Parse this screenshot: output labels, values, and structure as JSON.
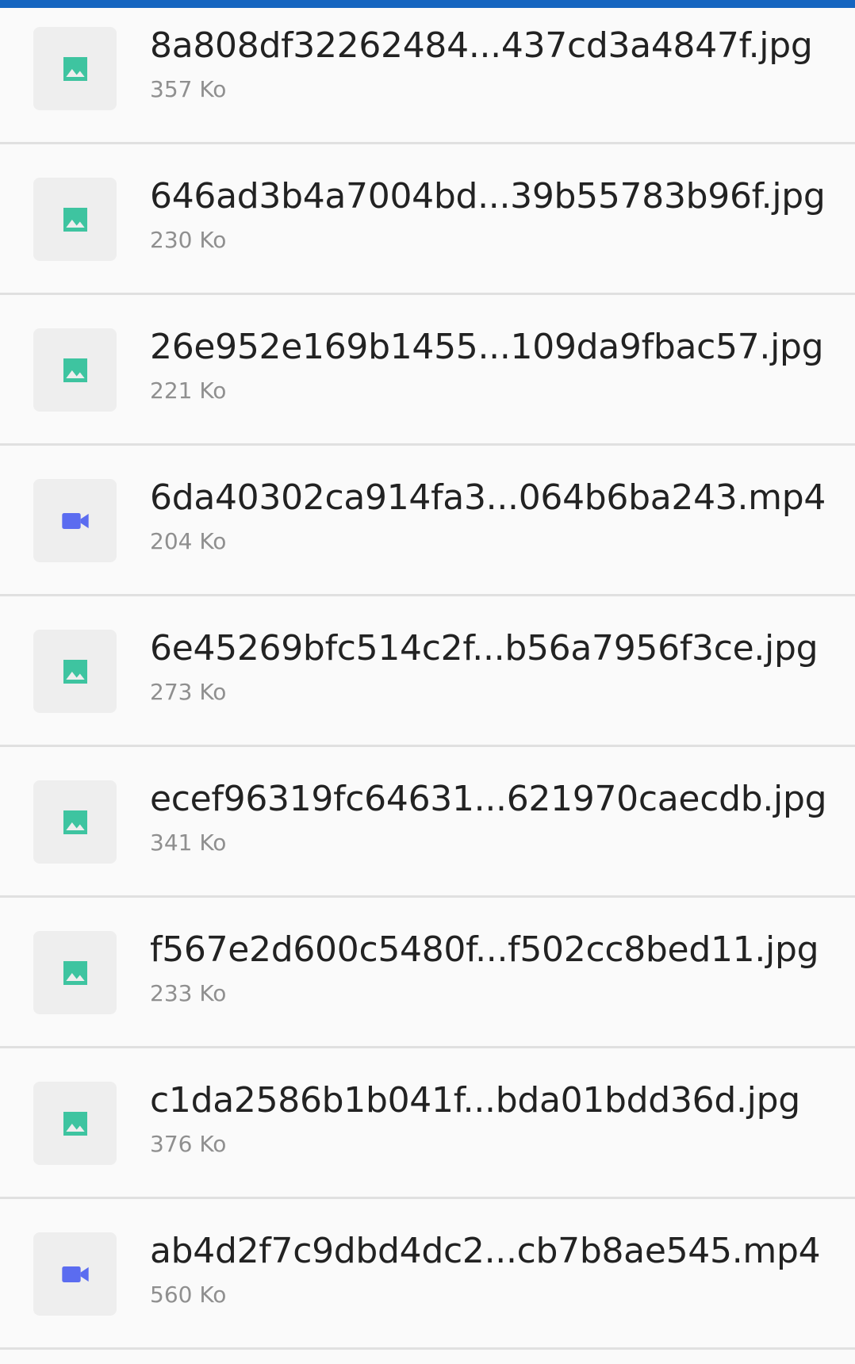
{
  "colors": {
    "top_bar": "#1565c0",
    "image_icon": "#3ec4a0",
    "video_icon": "#5b6cf0"
  },
  "files": [
    {
      "name": "8a808df32262484...437cd3a4847f.jpg",
      "size": "357 Ko",
      "icon": "image-icon"
    },
    {
      "name": "646ad3b4a7004bd...39b55783b96f.jpg",
      "size": "230 Ko",
      "icon": "image-icon"
    },
    {
      "name": "26e952e169b1455...109da9fbac57.jpg",
      "size": "221 Ko",
      "icon": "image-icon"
    },
    {
      "name": "6da40302ca914fa3...064b6ba243.mp4",
      "size": "204 Ko",
      "icon": "video-icon"
    },
    {
      "name": "6e45269bfc514c2f...b56a7956f3ce.jpg",
      "size": "273 Ko",
      "icon": "image-icon"
    },
    {
      "name": "ecef96319fc64631...621970caecdb.jpg",
      "size": "341 Ko",
      "icon": "image-icon"
    },
    {
      "name": "f567e2d600c5480f...f502cc8bed11.jpg",
      "size": "233 Ko",
      "icon": "image-icon"
    },
    {
      "name": "c1da2586b1b041f...bda01bdd36d.jpg",
      "size": "376 Ko",
      "icon": "image-icon"
    },
    {
      "name": "ab4d2f7c9dbd4dc2...cb7b8ae545.mp4",
      "size": "560 Ko",
      "icon": "video-icon"
    }
  ]
}
